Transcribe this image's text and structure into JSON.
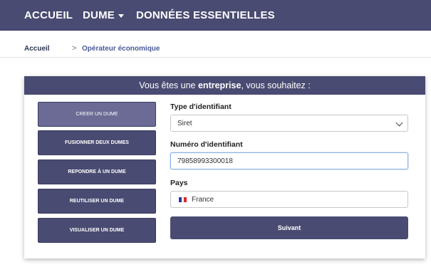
{
  "nav": {
    "items": [
      "ACCUEIL",
      "DUME",
      "DONNÉES ESSENTIELLES"
    ]
  },
  "breadcrumb": {
    "home": "Accueil",
    "separator": ">",
    "current": "Opérateur économique"
  },
  "card": {
    "header_prefix": "Vous êtes une ",
    "header_bold": "entreprise",
    "header_suffix": ", vous souhaitez :",
    "actions": [
      "CREER UN DUME",
      "FUSIONNER DEUX DUMES",
      "REPONDRE À UN DUME",
      "REUTILISER UN DUME",
      "VISUALISER UN DUME"
    ],
    "active_action_index": 0,
    "form": {
      "type_label": "Type d'identifiant",
      "type_value": "Siret",
      "number_label": "Numéro d'identifiant",
      "number_value": "79858993300018",
      "country_label": "Pays",
      "country_value": "France",
      "submit_label": "Suivant"
    }
  },
  "colors": {
    "primary": "#494b72",
    "active_button": "#6b6b95",
    "flag": [
      "#1f3f9a",
      "#ffffff",
      "#e1262d"
    ]
  }
}
